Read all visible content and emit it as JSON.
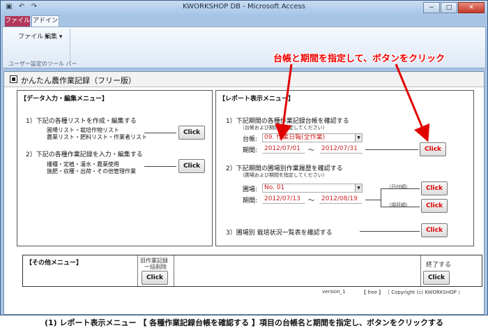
{
  "window": {
    "title": "KWORKSHOP DB - Microsoft Access",
    "min_label": "−",
    "max_label": "□",
    "close_label": "✕"
  },
  "ribbon": {
    "tab_file": "ファイル",
    "tab_addin": "アドイン",
    "menu_file": "ファイル ▾",
    "menu_edit": "編集 ▾",
    "toolbar_caption": "ユーザー設定のツール バー"
  },
  "form": {
    "title": "かんたん農作業記録（フリー版）"
  },
  "data_menu": {
    "title": "【データ入力・編集メニュー】",
    "item1_heading": "1）下記の各種リストを作成・編集する",
    "item1_line1": "圃場リスト・栽培作物リスト",
    "item1_line2": "農薬リスト・肥料リスト・作業者リスト",
    "item1_button": "Click",
    "item2_heading": "2）下記の各種作業記録を入力・編集する",
    "item2_line1": "播種・定植・灌水・農薬使用",
    "item2_line2": "施肥・収穫・出荷・その他管理作業",
    "item2_button": "Click"
  },
  "report_menu": {
    "title": "【レポート表示メニュー】",
    "item1_heading": "1）下記期間の各種作業記録台帳を確認する",
    "item1_note": "（台帳および期間を指定してください）",
    "ledger_label": "台帳:",
    "ledger_value": "09. 作業日報(全作業)",
    "period_label": "期間:",
    "period1_from": "2012/07/01",
    "period1_to": "2012/07/31",
    "tilde": "〜",
    "item1_button": "Click",
    "item2_heading": "2）下記期間の圃場別作業履歴を確認する",
    "item2_note": "（圃場および期間を指定してください）",
    "field_label": "圃場:",
    "field_value": "No. 01",
    "period2_label": "期間:",
    "period2_from": "2012/07/13",
    "period2_to": "2012/08/19",
    "by_date_label": "（日付順）",
    "by_item_label": "（項目順）",
    "item2_button_date": "Click",
    "item2_button_item": "Click",
    "item3_heading": "3）圃場別 栽培状況一覧表を確認する",
    "item3_button": "Click"
  },
  "other_menu": {
    "title": "【その他メニュー】",
    "bulk_delete_label1": "旧作業記録",
    "bulk_delete_label2": "一括削除",
    "bulk_delete_button": "Click",
    "exit_label": "終了する",
    "exit_button": "Click"
  },
  "footer": {
    "version": "version_1",
    "edition": "【 free 】",
    "copyright": "（ Copyright (c) KWORKSHOP ）"
  },
  "annotation": {
    "text": "台帳と期間を指定して、ボタンをクリック",
    "color": "#e00000"
  },
  "caption": {
    "text": "(1) レポート表示メニュー 【 各種作業記録台帳を確認する 】項目の台帳名と期間を指定し、ボタンをクリックする"
  },
  "icons": [
    "window-icon",
    "undo-icon",
    "redo-icon",
    "form-icon",
    "combo-arrow-icon"
  ]
}
